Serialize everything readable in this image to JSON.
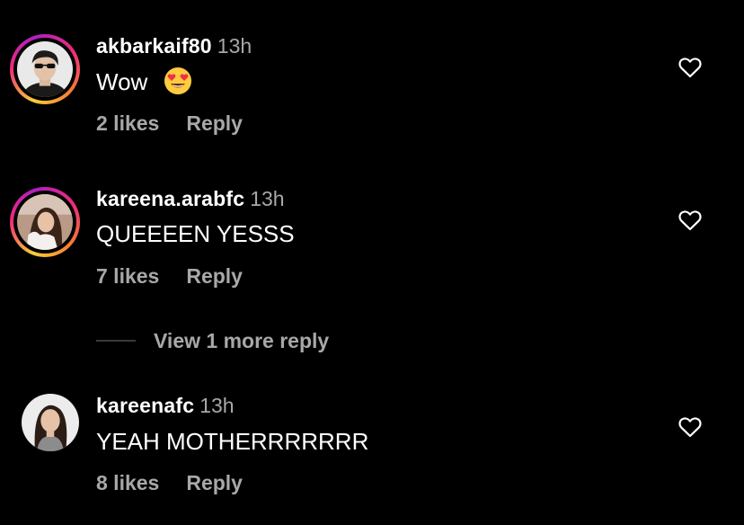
{
  "comments": [
    {
      "username": "akbarkaif80",
      "time": "13h",
      "text": "Wow",
      "emoji": "heart-eyes-emoji",
      "likes": "2 likes",
      "reply": "Reply"
    },
    {
      "username": "kareena.arabfc",
      "time": "13h",
      "text": "QUEEEEN YESSS",
      "likes": "7 likes",
      "reply": "Reply"
    },
    {
      "username": "kareenafc",
      "time": "13h",
      "text": "YEAH MOTHERRRRRRR",
      "likes": "8 likes",
      "reply": "Reply"
    }
  ],
  "view_more": "View 1 more reply",
  "colors": {
    "background": "#000000",
    "primary_text": "#ffffff",
    "secondary_text": "#a8a8a8",
    "story_ring": "#ee2a7b"
  }
}
